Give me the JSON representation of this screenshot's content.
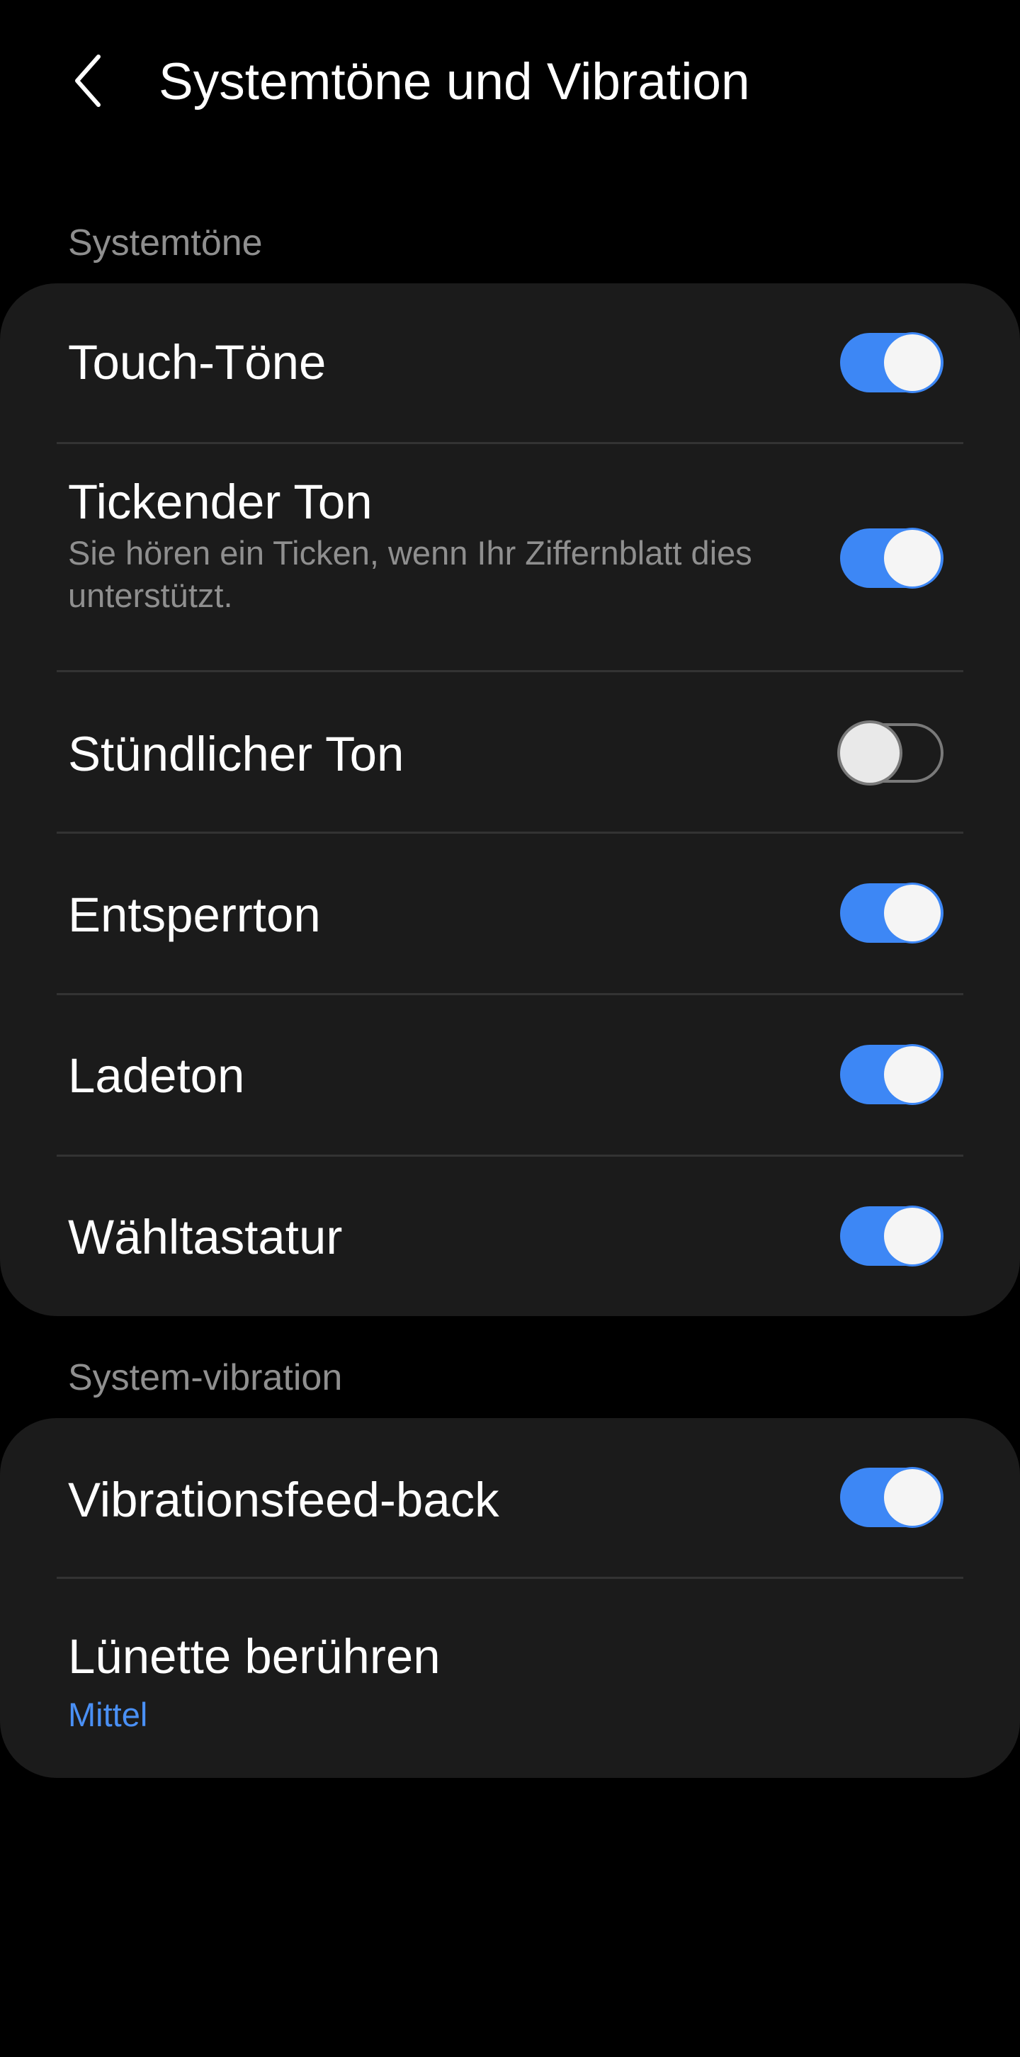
{
  "header": {
    "title": "Systemtöne und Vibration",
    "back_icon": "chevron-left-icon"
  },
  "sections": {
    "system_tones": {
      "label": "Systemtöne",
      "items": [
        {
          "title": "Touch-Töne",
          "enabled": true
        },
        {
          "title": "Tickender Ton",
          "subtitle": "Sie hören ein Ticken, wenn Ihr Ziffernblatt dies unterstützt.",
          "enabled": true
        },
        {
          "title": "Stündlicher Ton",
          "enabled": false
        },
        {
          "title": "Entsperrton",
          "enabled": true
        },
        {
          "title": "Ladeton",
          "enabled": true
        },
        {
          "title": "Wähltastatur",
          "enabled": true
        }
      ]
    },
    "system_vibration": {
      "label": "System-vibration",
      "items": [
        {
          "title": "Vibrationsfeed-back",
          "enabled": true
        },
        {
          "title": "Lünette berühren",
          "value": "Mittel"
        }
      ]
    }
  },
  "colors": {
    "accent": "#3d87f5",
    "value_text": "#4a90f5",
    "card_bg": "#1b1b1b",
    "page_bg": "#000000",
    "secondary_text": "#8f8f8f"
  }
}
